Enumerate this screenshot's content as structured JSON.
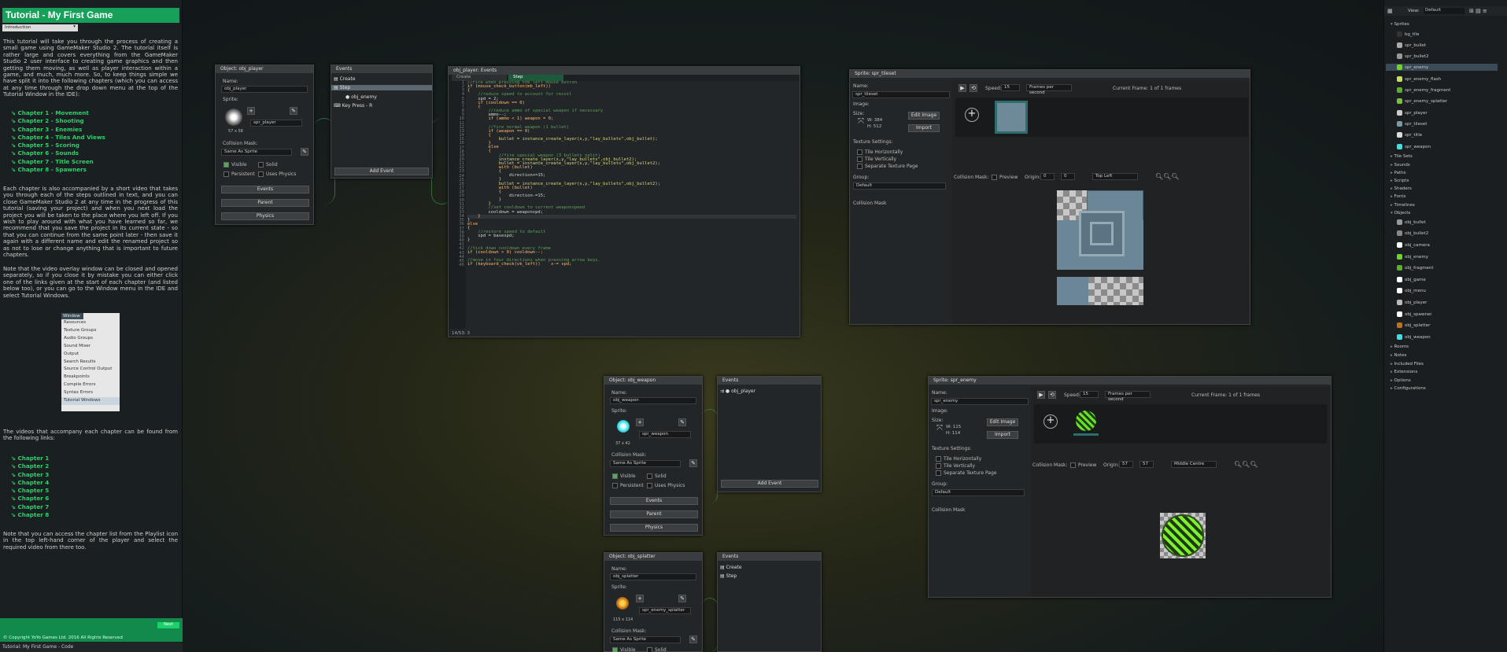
{
  "tutorial": {
    "title": "Tutorial - My First Game",
    "dropdown": "Introduction",
    "intro": "This tutorial will take you through the process of creating a small game using GameMaker Studio 2. The tutorial itself is rather large and covers everything from the GameMaker Studio 2 user interface to creating game graphics and then getting them moving, as well as player interaction within a game, and much, much more. So, to keep things simple we have split it into the following chapters (which you can access at any time through the drop down menu at the top of the Tutorial Window in the IDE):",
    "chapters": [
      "Chapter 1 - Movement",
      "Chapter 2 - Shooting",
      "Chapter 3 - Enemies",
      "Chapter 4 - Tiles And Views",
      "Chapter 5 - Scoring",
      "Chapter 6 - Sounds",
      "Chapter 7 - Title Screen",
      "Chapter 8 - Spawners"
    ],
    "para2": "Each chapter is also accompanied by a short video that takes you through each of the steps outlined in text, and you can close GameMaker Studio 2 at any time in the progress of this tutorial (saving your project) and when you next load the project you will be taken to the place where you left off. If you wish to play around with what you have learned so far, we recommend that you save the project in its current state - so that you can continue from the same point later - then save it again with a different name and edit the renamed project so as not to lose or change anything that is important to future chapters.",
    "para3": "Note that the video overlay window can be closed and opened separately, so if you close it by mistake you can either click one of the links given at the start of each chapter (and listed below too), or you can go to the Window menu in the IDE and select Tutorial Windows.",
    "window_menu": {
      "title": "Window",
      "items": [
        "Resources",
        "Texture Groups",
        "Audio Groups",
        "Sound Mixer",
        "Output",
        "Search Results",
        "Source Control Output",
        "Breakpoints",
        "Compile Errors",
        "Syntax Errors",
        "Tutorial Windows"
      ]
    },
    "para4": "The videos that accompany each chapter can be found from the following links:",
    "video_links": [
      "Chapter 1",
      "Chapter 2",
      "Chapter 3",
      "Chapter 4",
      "Chapter 5",
      "Chapter 6",
      "Chapter 7",
      "Chapter 8"
    ],
    "para5": "Note that you can access the chapter list from the Playlist icon in the top left-hand corner of the player and select the required video from there too.",
    "next": "Next",
    "copyright": "© Copyright YoYo Games Ltd. 2016 All Rights Reserved",
    "status": "Tutorial: My First Game - Code"
  },
  "obj_player": {
    "title": "Object: obj_player",
    "name_label": "Name:",
    "name": "obj_player",
    "sprite_label": "Sprite:",
    "sprite": "spr_player",
    "size": "57 x 58",
    "mask_label": "Collision Mask:",
    "mask": "Same As Sprite",
    "visible": "Visible",
    "solid": "Solid",
    "persistent": "Persistent",
    "physics_chk": "Uses Physics",
    "events_btn": "Events",
    "parent_btn": "Parent",
    "physics_btn": "Physics"
  },
  "events_player": {
    "title": "Events",
    "items": [
      "Create",
      "Step",
      "obj_enemy",
      "Key Press - R"
    ],
    "add": "Add Event"
  },
  "code": {
    "title": "obj_player: Events",
    "tabs": [
      "Create",
      "Step"
    ],
    "position": "14/53: 3",
    "lines": [
      "//Fire when pressing the left mouse button",
      "if (mouse_check_button(mb_left))",
      "{",
      "    //reduce speed to account for recoil",
      "    spd = 2;",
      "    if (cooldown == 0)",
      "    {",
      "        //reduce ammo of special weapon if necessary",
      "        ammo--;",
      "        if (ammo < 1) weapon = 0;",
      "",
      "        //fire normal weapon (1 bullet)",
      "        if (weapon == 0)",
      "        {",
      "            bullet = instance_create_layer(x,y,\"lay_bullets\",obj_bullet);",
      "        }",
      "        else",
      "        {",
      "            //fire special weapon (3 bullets split)",
      "            instance_create_layer(x,y,\"lay_bullets\",obj_bullet2);",
      "            bullet = instance_create_layer(x,y,\"lay_bullets\",obj_bullet2);",
      "            with (bullet)",
      "            {",
      "                direction+=15;",
      "            }",
      "            bullet = instance_create_layer(x,y,\"lay_bullets\",obj_bullet2);",
      "            with (bullet)",
      "            {",
      "                direction-=15;",
      "            }",
      "        }",
      "        //set cooldown to current weaponspeed",
      "        cooldown = weaponspd;",
      "    }",
      "}",
      "else",
      "{",
      "    //restore speed to default",
      "    spd = basespd;",
      "}",
      "",
      "//tick down cooldown every frame",
      "if (cooldown > 0) cooldown--;",
      "",
      "//move in four directions when pressing arrow keys.",
      "if (keyboard_check(vk_left))    x-= spd;"
    ]
  },
  "spr_tileset": {
    "title": "Sprite: spr_tileset",
    "name_label": "Name:",
    "name": "spr_tileset",
    "image_label": "Image:",
    "size_label": "Size:",
    "w": "W: 384",
    "h": "H: 512",
    "edit": "Edit Image",
    "import": "Import",
    "texture": "Texture Settings:",
    "tile_h": "Tile Horizontally",
    "tile_v": "Tile Vertically",
    "separate": "Separate Texture Page",
    "group_label": "Group:",
    "group": "Default",
    "collision": "Collision Mask",
    "speed_label": "Speed:",
    "speed": "15",
    "fps": "Frames per second",
    "frame": "Current Frame: 1 of 1 frames",
    "coll_mask": "Collision Mask:",
    "preview": "Preview",
    "origin_label": "Origin:",
    "ox": "0",
    "oy": "0",
    "origin_pos": "Top Left"
  },
  "obj_weapon": {
    "title": "Object: obj_weapon",
    "name": "obj_weapon",
    "sprite": "spr_weapon",
    "size": "37 x 42",
    "mask": "Same As Sprite",
    "events_items": [
      "obj_player"
    ]
  },
  "spr_enemy": {
    "title": "Sprite: spr_enemy",
    "name": "spr_enemy",
    "w": "W: 115",
    "h": "H: 114",
    "speed": "15",
    "ox": "57",
    "oy": "57",
    "origin_pos": "Middle Centre",
    "frame": "Current Frame: 1 of 1 frames"
  },
  "obj_splatter": {
    "title": "Object: obj_splatter",
    "name": "obj_splatter",
    "sprite": "spr_enemy_splatter",
    "size": "115 x 114",
    "mask": "Same As Sprite",
    "events_items": [
      "Create",
      "Step"
    ]
  },
  "tree": {
    "view_label": "View:",
    "view": "Default",
    "sprites_group": "Sprites",
    "sprites": [
      "bg_tile",
      "spr_bullet",
      "spr_bullet2",
      "spr_enemy",
      "spr_enemy_flash",
      "spr_enemy_fragment",
      "spr_enemy_splatter",
      "spr_player",
      "spr_tileset",
      "spr_title",
      "spr_weapon"
    ],
    "mid_groups": [
      "Tile Sets",
      "Sounds",
      "Paths",
      "Scripts",
      "Shaders",
      "Fonts",
      "Timelines"
    ],
    "objects_group": "Objects",
    "objects": [
      "obj_bullet",
      "obj_bullet2",
      "obj_camera",
      "obj_enemy",
      "obj_fragment",
      "obj_game",
      "obj_menu",
      "obj_player",
      "obj_spawner",
      "obj_splatter",
      "obj_weapon"
    ],
    "end_groups": [
      "Rooms",
      "Notes",
      "Included Files",
      "Extensions",
      "Options",
      "Configurations"
    ]
  },
  "colors": {
    "accent": "#16a05a",
    "chapter_link": "#2fcf6a",
    "panel": "#232628",
    "selection": "#3a4a56"
  }
}
